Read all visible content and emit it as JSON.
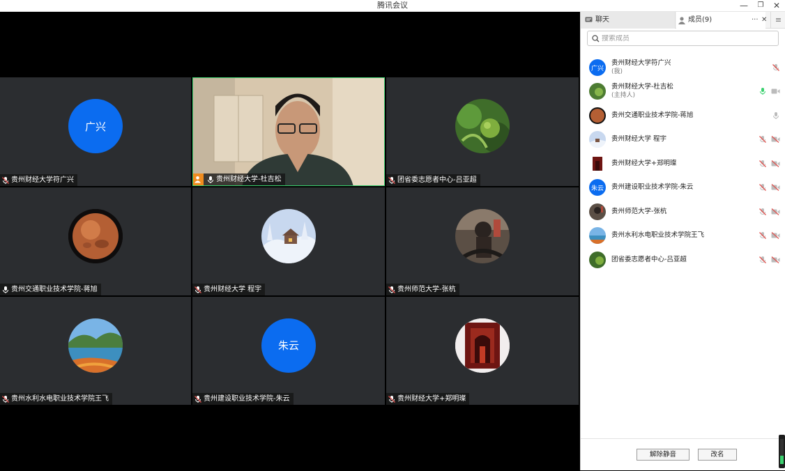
{
  "window": {
    "title": "腾讯会议",
    "minimize": "—",
    "restore": "❐",
    "close": "✕"
  },
  "tiles": [
    {
      "name": "贵州财经大学符广兴",
      "avatar_text": "广兴"
    },
    {
      "name": "贵州财经大学-杜吉松",
      "host": true
    },
    {
      "name": "团省委志愿者中心-吕亚超"
    },
    {
      "name": "贵州交通职业技术学院-蒋旭"
    },
    {
      "name": "贵州财经大学 程宇"
    },
    {
      "name": "贵州师范大学-张杭"
    },
    {
      "name": "贵州水利水电职业技术学院王飞"
    },
    {
      "name": "贵州建设职业技术学院-朱云",
      "avatar_text": "朱云"
    },
    {
      "name": "贵州财经大学+郑明璨"
    }
  ],
  "panel": {
    "tab_chat": "聊天",
    "tab_members": "成员(9)",
    "more": "···",
    "close": "✕",
    "menu": "≡",
    "search_placeholder": "搜索成员",
    "members": [
      {
        "name": "贵州财经大学符广兴",
        "sub": "(我)",
        "avatar_text": "广兴"
      },
      {
        "name": "贵州财经大学-杜吉松",
        "sub": "(主持人)"
      },
      {
        "name": "贵州交通职业技术学院-蒋旭"
      },
      {
        "name": "贵州财经大学 程宇"
      },
      {
        "name": "贵州财经大学+郑明璨"
      },
      {
        "name": "贵州建设职业技术学院-朱云",
        "avatar_text": "朱云"
      },
      {
        "name": "贵州师范大学-张杭"
      },
      {
        "name": "贵州水利水电职业技术学院王飞"
      },
      {
        "name": "团省委志愿者中心-吕亚超"
      }
    ],
    "unmute_label": "解除静音",
    "rename_label": "改名"
  },
  "colors": {
    "accent": "#0b6cf0",
    "host_badge": "#f08c1e",
    "active_border": "#3bd16f",
    "muted_red": "#e0524f"
  }
}
